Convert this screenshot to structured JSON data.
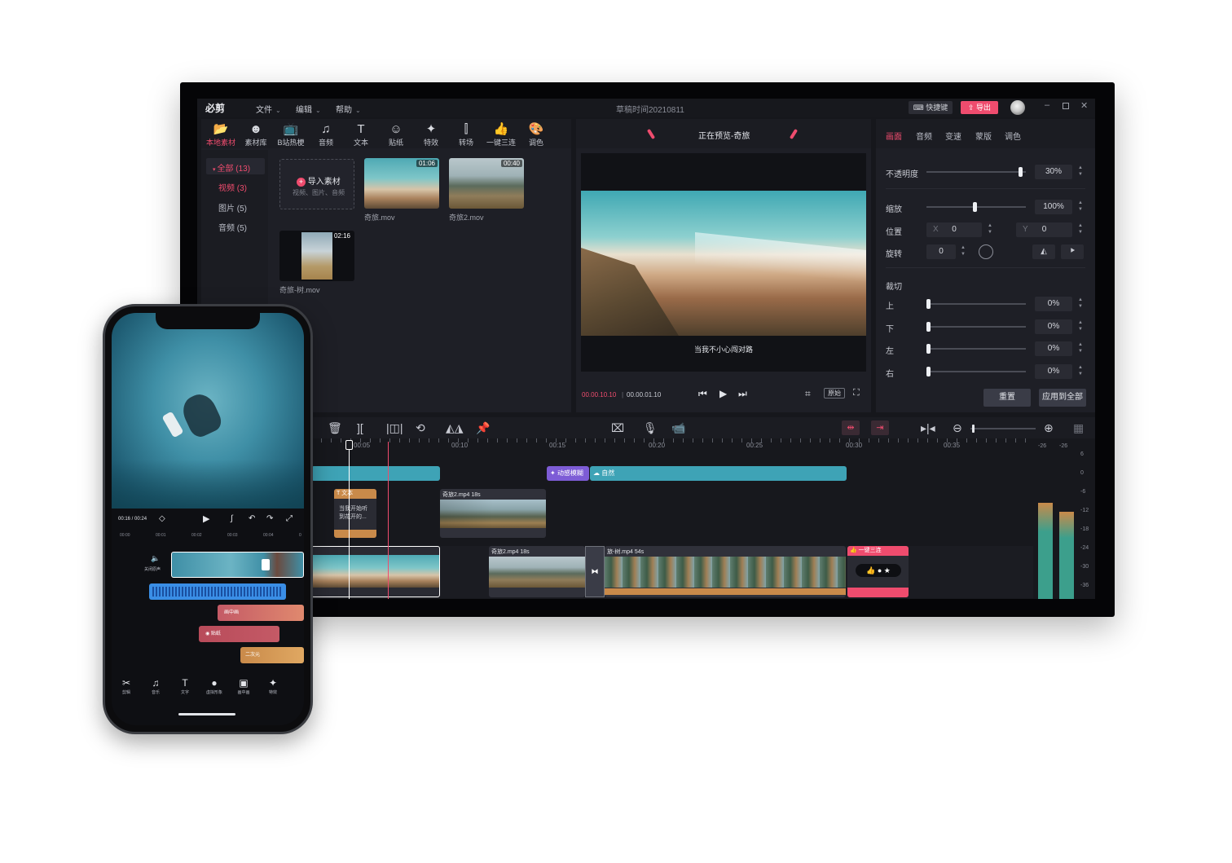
{
  "app": {
    "logo": "必剪",
    "menus": [
      "文件",
      "编辑",
      "帮助"
    ],
    "title": "草稿时间20210811",
    "shortcut_label": "快捷键",
    "export_label": "导出"
  },
  "toolbar": [
    {
      "icon": "upload-folder-icon",
      "label": "本地素材",
      "active": true
    },
    {
      "icon": "material-library-icon",
      "label": "素材库"
    },
    {
      "icon": "tv-icon",
      "label": "B站热梗"
    },
    {
      "icon": "music-note-icon",
      "label": "音频"
    },
    {
      "icon": "text-icon",
      "label": "文本"
    },
    {
      "icon": "sticker-icon",
      "label": "贴纸"
    },
    {
      "icon": "effects-icon",
      "label": "特效"
    },
    {
      "icon": "transition-icon",
      "label": "转场"
    },
    {
      "icon": "thumbs-up-icon",
      "label": "一键三连"
    },
    {
      "icon": "palette-icon",
      "label": "调色"
    }
  ],
  "sidebar": [
    "全部 (13)",
    "视频 (3)",
    "图片 (5)",
    "音频 (5)"
  ],
  "media": {
    "import_label": "导入素材",
    "import_hint": "视频、图片、音频",
    "items": [
      {
        "name": "奇旅.mov",
        "duration": "01:06"
      },
      {
        "name": "奇旅2.mov",
        "duration": "00:40"
      },
      {
        "name": "奇旅-树.mov",
        "duration": "02:16"
      }
    ]
  },
  "preview": {
    "title": "正在预览-奇旅",
    "subtitle": "当我不小心闯对路",
    "current_time": "00.00.10.10",
    "total_time": "00.00.01.10",
    "original_label": "原始"
  },
  "props": {
    "tabs": [
      "画面",
      "音频",
      "变速",
      "蒙版",
      "调色"
    ],
    "opacity_label": "不透明度",
    "opacity_value": "30%",
    "opacity": 0.97,
    "scale_label": "缩放",
    "scale_value": "100%",
    "scale": 0.49,
    "position_label": "位置",
    "x_label": "X",
    "x_value": "0",
    "y_label": "Y",
    "y_value": "0",
    "rotate_label": "旋转",
    "rotate_value": "0",
    "crop_label": "裁切",
    "crop": [
      {
        "label": "上",
        "value": "0%"
      },
      {
        "label": "下",
        "value": "0%"
      },
      {
        "label": "左",
        "value": "0%"
      },
      {
        "label": "右",
        "value": "0%"
      }
    ],
    "reset_label": "重置",
    "apply_all_label": "应用到全部"
  },
  "timeline": {
    "ticks": [
      "00:05",
      "00:10",
      "00:15",
      "00:20",
      "00:25",
      "00:30",
      "00:35"
    ],
    "effect1": "动感模糊",
    "effect2": "自然",
    "text_clip_label": "文本",
    "text_clip_text": "当我开始听\n到花开的...",
    "clip2": "奇旅2.mp4   18s",
    "clip3": "奇旅2.mp4   18s",
    "clip4": "旅-树.mp4   54s",
    "triple_label": "一键三连",
    "meter_ticks": [
      "6",
      "0",
      "-6",
      "-12",
      "-18",
      "-24",
      "-30",
      "-36"
    ],
    "meter_peaks": [
      "-26",
      "-26"
    ]
  },
  "phone": {
    "time": "00:16 / 00:24",
    "ruler": [
      "00:00",
      "00:01",
      "00:02",
      "00:03",
      "00:04",
      "0"
    ],
    "mute_label": "关闭原声",
    "clip_pip": "画中画",
    "clip_sticker": "贴纸",
    "clip_anime": "二次元",
    "nav": [
      {
        "icon": "scissors-icon",
        "label": "剪辑"
      },
      {
        "icon": "music-icon",
        "label": "音乐"
      },
      {
        "icon": "text-icon",
        "label": "文字"
      },
      {
        "icon": "avatar-icon",
        "label": "虚拟形象"
      },
      {
        "icon": "pip-icon",
        "label": "画中画"
      },
      {
        "icon": "effects-icon",
        "label": "特效"
      }
    ]
  },
  "colors": {
    "accent": "#ef4c6e",
    "teal": "#3ea3b6",
    "purple": "#7d5cd6"
  }
}
